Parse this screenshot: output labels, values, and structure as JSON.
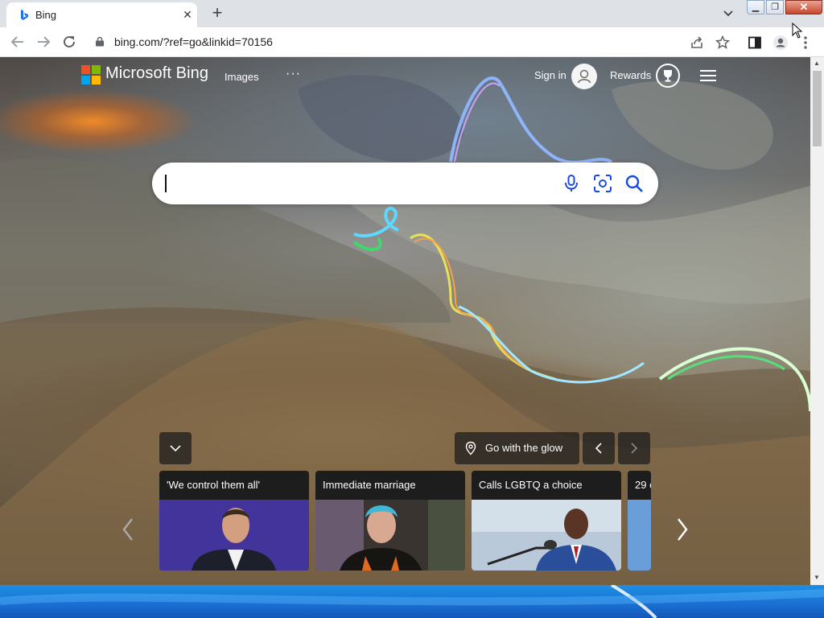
{
  "browser": {
    "tab_title": "Bing",
    "tab_close": "✕",
    "new_tab": "+",
    "address": "bing.com/?ref=go&linkid=70156",
    "window_controls": {
      "minimize": "▁",
      "maximize": "❐",
      "close": "✕"
    }
  },
  "header": {
    "brand": "Microsoft Bing",
    "images_label": "Images",
    "more_label": "···",
    "signin_label": "Sign in",
    "rewards_label": "Rewards"
  },
  "search": {
    "value": "",
    "placeholder": ""
  },
  "location": {
    "label": "Go with the glow"
  },
  "news": [
    {
      "caption": "'We control them all'"
    },
    {
      "caption": "Immediate marriage"
    },
    {
      "caption": "Calls LGBTQ a choice"
    },
    {
      "caption": "29 c"
    }
  ],
  "colors": {
    "accent": "#174ae4",
    "chrome_bg": "#dee1e6",
    "card_bg": "#1d1d1d"
  }
}
